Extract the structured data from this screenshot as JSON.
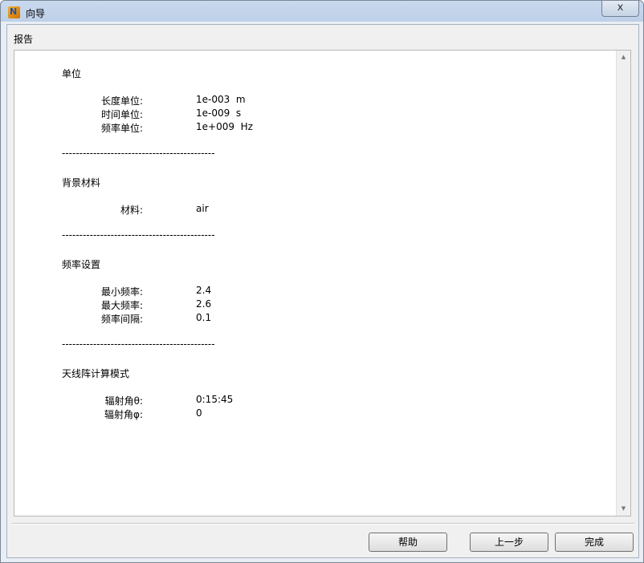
{
  "window": {
    "title": "向导",
    "icon": "app-icon",
    "close_label": "x"
  },
  "header": {
    "label": "报告"
  },
  "sections": [
    {
      "title": "单位",
      "rows": [
        {
          "label": "长度单位:",
          "value": "1e-003  m"
        },
        {
          "label": "时间单位:",
          "value": "1e-009  s"
        },
        {
          "label": "频率单位:",
          "value": "1e+009  Hz"
        }
      ]
    },
    {
      "title": "背景材料",
      "rows": [
        {
          "label": "材料:",
          "value": "air"
        }
      ]
    },
    {
      "title": "频率设置",
      "rows": [
        {
          "label": "最小频率:",
          "value": "2.4"
        },
        {
          "label": "最大频率:",
          "value": "2.6"
        },
        {
          "label": "频率间隔:",
          "value": "0.1"
        }
      ]
    },
    {
      "title": "天线阵计算模式",
      "rows": [
        {
          "label": "辐射角θ:",
          "value": "0:15:45"
        },
        {
          "label": "辐射角φ:",
          "value": "0"
        }
      ]
    }
  ],
  "divider": "--------------------------------------------",
  "buttons": {
    "help": "帮助",
    "back": "上一步",
    "finish": "完成"
  }
}
